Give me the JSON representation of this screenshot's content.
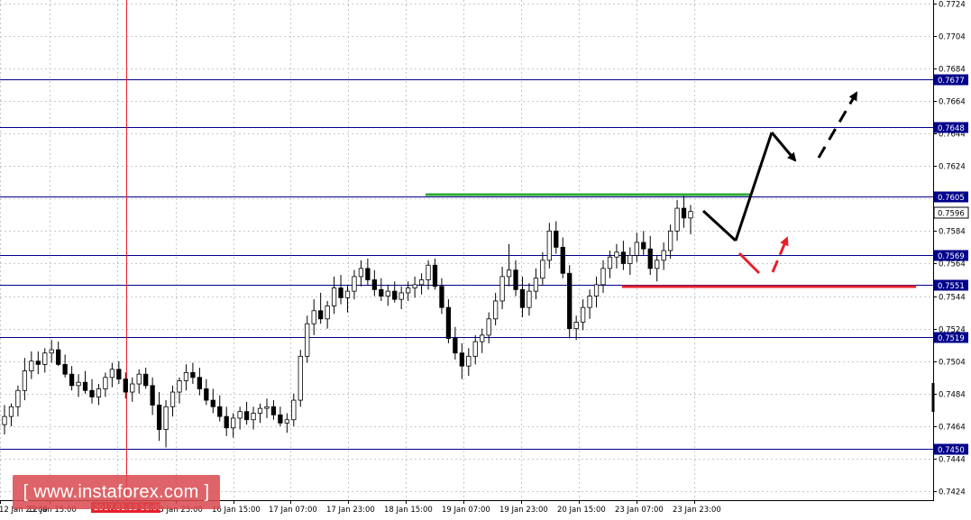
{
  "chart_data": {
    "type": "candlestick",
    "y_axis": {
      "ylim": [
        0.7418,
        0.7726
      ],
      "position": "right",
      "ticks": [
        "0.7724",
        "0.7704",
        "0.7684",
        "0.7664",
        "0.7644",
        "0.7624",
        "0.7604",
        "0.7584",
        "0.7564",
        "0.7544",
        "0.7524",
        "0.7504",
        "0.7484",
        "0.7464",
        "0.7444",
        "0.7424"
      ]
    },
    "x_axis": {
      "labels": [
        "12 Jan 23:00",
        "12 Jan 15:00",
        "13 Jan 07:00",
        "13 Jan 23:00",
        "16 Jan 15:00",
        "17 Jan 07:00",
        "17 Jan 23:00",
        "18 Jan 15:00",
        "19 Jan 07:00",
        "19 Jan 23:00",
        "20 Jan 15:00",
        "23 Jan 07:00",
        "23 Jan 23:00"
      ]
    },
    "cursor": {
      "time_label": "2017.01.13 16:00"
    },
    "current_price": {
      "value": 0.7596,
      "label": "0.7596"
    },
    "levels": [
      {
        "value": 0.7677,
        "label": "0.7677"
      },
      {
        "value": 0.7648,
        "label": "0.7648"
      },
      {
        "value": 0.7605,
        "label": "0.7605"
      },
      {
        "value": 0.7569,
        "label": "0.7569"
      },
      {
        "value": 0.7551,
        "label": "0.7551"
      },
      {
        "value": 0.7519,
        "label": "0.7519"
      },
      {
        "value": 0.745,
        "label": "0.7450"
      }
    ],
    "colors": {
      "level_line": "#00008b",
      "level_label_bg": "#00008b",
      "green_line": "#2ea836",
      "red_line": "#e8202a",
      "cursor": "#e8202a",
      "candles": "#000000"
    },
    "candles_ohlc": [
      [
        0.7465,
        0.7477,
        0.7459,
        0.747
      ],
      [
        0.747,
        0.7478,
        0.7464,
        0.7476
      ],
      [
        0.7476,
        0.7489,
        0.747,
        0.7486
      ],
      [
        0.7486,
        0.7506,
        0.748,
        0.7498
      ],
      [
        0.7498,
        0.751,
        0.7493,
        0.7504
      ],
      [
        0.7504,
        0.751,
        0.7496,
        0.7502
      ],
      [
        0.7502,
        0.7512,
        0.7497,
        0.7509
      ],
      [
        0.7509,
        0.7517,
        0.7503,
        0.7511
      ],
      [
        0.7511,
        0.7516,
        0.7501,
        0.7502
      ],
      [
        0.7502,
        0.7508,
        0.7494,
        0.7496
      ],
      [
        0.7496,
        0.7501,
        0.7486,
        0.7489
      ],
      [
        0.7489,
        0.7496,
        0.7482,
        0.7491
      ],
      [
        0.7491,
        0.7498,
        0.7484,
        0.7486
      ],
      [
        0.7486,
        0.7493,
        0.7478,
        0.7482
      ],
      [
        0.7482,
        0.749,
        0.7477,
        0.7487
      ],
      [
        0.7487,
        0.7497,
        0.7482,
        0.7494
      ],
      [
        0.7494,
        0.7503,
        0.7488,
        0.7499
      ],
      [
        0.7499,
        0.7504,
        0.749,
        0.7493
      ],
      [
        0.7493,
        0.7497,
        0.7481,
        0.7485
      ],
      [
        0.7485,
        0.7494,
        0.7479,
        0.749
      ],
      [
        0.749,
        0.7499,
        0.7484,
        0.7496
      ],
      [
        0.7496,
        0.75,
        0.7487,
        0.7489
      ],
      [
        0.7489,
        0.7494,
        0.7471,
        0.7477
      ],
      [
        0.7477,
        0.7485,
        0.7455,
        0.7462
      ],
      [
        0.7462,
        0.748,
        0.7451,
        0.7476
      ],
      [
        0.7476,
        0.7489,
        0.747,
        0.7485
      ],
      [
        0.7485,
        0.7494,
        0.7478,
        0.7492
      ],
      [
        0.7492,
        0.7502,
        0.7486,
        0.7497
      ],
      [
        0.7497,
        0.7503,
        0.749,
        0.7494
      ],
      [
        0.7494,
        0.75,
        0.7483,
        0.7487
      ],
      [
        0.7487,
        0.7493,
        0.7477,
        0.748
      ],
      [
        0.748,
        0.7487,
        0.7472,
        0.7476
      ],
      [
        0.7476,
        0.7483,
        0.7467,
        0.747
      ],
      [
        0.747,
        0.7476,
        0.7458,
        0.7463
      ],
      [
        0.7463,
        0.7472,
        0.7457,
        0.7469
      ],
      [
        0.7469,
        0.7476,
        0.7462,
        0.7473
      ],
      [
        0.7473,
        0.7479,
        0.7465,
        0.7468
      ],
      [
        0.7468,
        0.7476,
        0.7462,
        0.7472
      ],
      [
        0.7472,
        0.7478,
        0.7466,
        0.7475
      ],
      [
        0.7475,
        0.7481,
        0.7469,
        0.7476
      ],
      [
        0.7476,
        0.748,
        0.7468,
        0.7471
      ],
      [
        0.7471,
        0.7476,
        0.7464,
        0.7466
      ],
      [
        0.7466,
        0.7472,
        0.746,
        0.7468
      ],
      [
        0.7468,
        0.7484,
        0.7464,
        0.748
      ],
      [
        0.748,
        0.7511,
        0.7476,
        0.7507
      ],
      [
        0.7507,
        0.7532,
        0.7503,
        0.7527
      ],
      [
        0.7527,
        0.7542,
        0.752,
        0.7535
      ],
      [
        0.7535,
        0.7546,
        0.7527,
        0.753
      ],
      [
        0.753,
        0.7541,
        0.7524,
        0.7538
      ],
      [
        0.7538,
        0.7556,
        0.7533,
        0.7549
      ],
      [
        0.7549,
        0.7557,
        0.7539,
        0.7543
      ],
      [
        0.7543,
        0.7551,
        0.7534,
        0.7547
      ],
      [
        0.7547,
        0.756,
        0.7542,
        0.7556
      ],
      [
        0.7556,
        0.7566,
        0.755,
        0.7561
      ],
      [
        0.7561,
        0.7567,
        0.7551,
        0.7554
      ],
      [
        0.7554,
        0.756,
        0.7544,
        0.7548
      ],
      [
        0.7548,
        0.7555,
        0.7541,
        0.7544
      ],
      [
        0.7544,
        0.7551,
        0.7538,
        0.7547
      ],
      [
        0.7547,
        0.7553,
        0.754,
        0.7542
      ],
      [
        0.7542,
        0.755,
        0.7536,
        0.7546
      ],
      [
        0.7546,
        0.7553,
        0.7541,
        0.7549
      ],
      [
        0.7549,
        0.7556,
        0.7543,
        0.7551
      ],
      [
        0.7551,
        0.7558,
        0.7545,
        0.7554
      ],
      [
        0.7554,
        0.7566,
        0.7548,
        0.7563
      ],
      [
        0.7563,
        0.7567,
        0.7548,
        0.755
      ],
      [
        0.755,
        0.7555,
        0.7533,
        0.7537
      ],
      [
        0.7537,
        0.7542,
        0.7515,
        0.7518
      ],
      [
        0.7518,
        0.7525,
        0.7505,
        0.7509
      ],
      [
        0.7509,
        0.7515,
        0.7493,
        0.7501
      ],
      [
        0.7501,
        0.7512,
        0.7495,
        0.7507
      ],
      [
        0.7507,
        0.752,
        0.7502,
        0.7516
      ],
      [
        0.7516,
        0.7524,
        0.7509,
        0.752
      ],
      [
        0.752,
        0.7534,
        0.7515,
        0.753
      ],
      [
        0.753,
        0.7546,
        0.7526,
        0.7541
      ],
      [
        0.7541,
        0.7562,
        0.7536,
        0.7556
      ],
      [
        0.7556,
        0.7576,
        0.755,
        0.756
      ],
      [
        0.756,
        0.7566,
        0.7544,
        0.7548
      ],
      [
        0.7548,
        0.7556,
        0.7531,
        0.7537
      ],
      [
        0.7537,
        0.7552,
        0.7532,
        0.7547
      ],
      [
        0.7547,
        0.7561,
        0.7542,
        0.7555
      ],
      [
        0.7555,
        0.7571,
        0.7551,
        0.7566
      ],
      [
        0.7566,
        0.7589,
        0.7561,
        0.7584
      ],
      [
        0.7584,
        0.759,
        0.757,
        0.7574
      ],
      [
        0.7574,
        0.758,
        0.7555,
        0.7558
      ],
      [
        0.7558,
        0.7563,
        0.7518,
        0.7524
      ],
      [
        0.7524,
        0.7532,
        0.7517,
        0.7528
      ],
      [
        0.7528,
        0.7542,
        0.7523,
        0.7537
      ],
      [
        0.7537,
        0.7548,
        0.753,
        0.7544
      ],
      [
        0.7544,
        0.7556,
        0.7537,
        0.7551
      ],
      [
        0.7551,
        0.7566,
        0.7546,
        0.7561
      ],
      [
        0.7561,
        0.7572,
        0.7555,
        0.7568
      ],
      [
        0.7568,
        0.7576,
        0.7561,
        0.7571
      ],
      [
        0.7571,
        0.7578,
        0.756,
        0.7564
      ],
      [
        0.7564,
        0.7574,
        0.7557,
        0.7569
      ],
      [
        0.7569,
        0.7583,
        0.7565,
        0.7577
      ],
      [
        0.7577,
        0.7584,
        0.7569,
        0.7573
      ],
      [
        0.7573,
        0.7581,
        0.7557,
        0.7561
      ],
      [
        0.7561,
        0.7569,
        0.7553,
        0.7566
      ],
      [
        0.7566,
        0.7577,
        0.756,
        0.7572
      ],
      [
        0.7572,
        0.7588,
        0.7567,
        0.7584
      ],
      [
        0.7584,
        0.7603,
        0.7578,
        0.7598
      ],
      [
        0.7598,
        0.7607,
        0.7586,
        0.7592
      ],
      [
        0.7592,
        0.76,
        0.7582,
        0.7596
      ]
    ]
  },
  "watermark": {
    "text": "[ www.instaforex.com ]"
  },
  "forecast_arrows": {
    "black": [
      "down-left leg",
      "up leg",
      "down leg",
      "up continuation"
    ],
    "red": [
      "down leg",
      "up leg"
    ]
  }
}
